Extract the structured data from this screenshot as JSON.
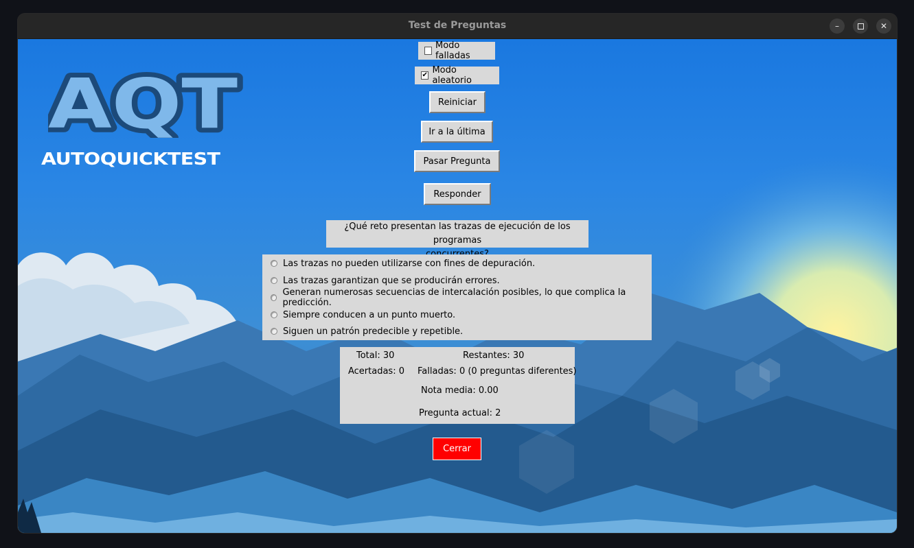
{
  "window": {
    "title": "Test de Preguntas",
    "controls": [
      "minimize-icon",
      "maximize-icon",
      "close-icon"
    ]
  },
  "logo": {
    "mark": "AQT",
    "wordmark": "AUTOQUICKTEST"
  },
  "toolbar": {
    "modo_falladas": {
      "label": "Modo falladas",
      "checked": false
    },
    "modo_aleatorio": {
      "label": "Modo aleatorio",
      "checked": true
    },
    "reiniciar_label": "Reiniciar",
    "ir_ultima_label": "Ir a la última",
    "pasar_label": "Pasar Pregunta",
    "responder_label": "Responder"
  },
  "question": {
    "line1": "¿Qué reto presentan las trazas de ejecución de los programas",
    "line2": "concurrentes?"
  },
  "options": [
    "Las trazas no pueden utilizarse con fines de depuración.",
    "Las trazas garantizan que se producirán errores.",
    "Generan numerosas secuencias de intercalación posibles, lo que complica la predicción.",
    "Siempre conducen a un punto muerto.",
    "Siguen un patrón predecible y repetible."
  ],
  "stats": {
    "total": "Total: 30",
    "restantes": "Restantes: 30",
    "acertadas": "Acertadas: 0",
    "falladas": "Falladas: 0 (0 preguntas diferentes)",
    "nota_media": "Nota media: 0.00",
    "pregunta_actual": "Pregunta actual: 2"
  },
  "close_label": "Cerrar",
  "colors": {
    "close_button": "#ff0000",
    "panel_bg": "#d9d9d9",
    "sky": "#1a78e0"
  }
}
